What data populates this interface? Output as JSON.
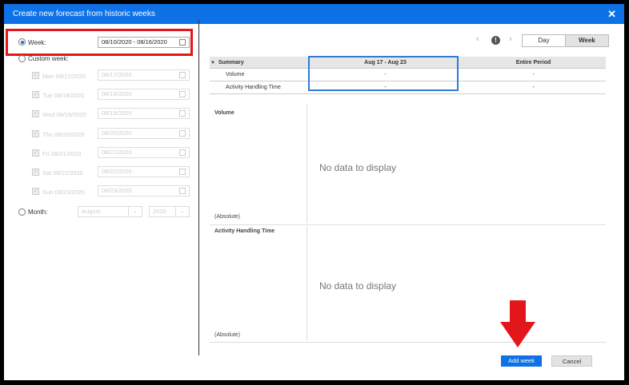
{
  "dialog": {
    "title": "Create new forecast from historic weeks",
    "close": "✕"
  },
  "left": {
    "week_label": "Week:",
    "week_value": "08/10/2020 - 08/16/2020",
    "custom_week_label": "Custom week:",
    "days": [
      {
        "label": "Mon 08/17/2020",
        "value": "08/17/2020"
      },
      {
        "label": "Tue 08/18/2020",
        "value": "08/18/2020"
      },
      {
        "label": "Wed 08/19/2020",
        "value": "08/19/2020"
      },
      {
        "label": "Thu 08/20/2020",
        "value": "08/20/2020"
      },
      {
        "label": "Fri 08/21/2020",
        "value": "08/21/2020"
      },
      {
        "label": "Sat 08/22/2020",
        "value": "08/22/2020"
      },
      {
        "label": "Sun 08/23/2020",
        "value": "08/23/2020"
      }
    ],
    "month_label": "Month:",
    "month_value": "August",
    "year_value": "2020"
  },
  "right": {
    "prev": "‹",
    "next": "›",
    "info": "!",
    "toggle_day": "Day",
    "toggle_week": "Week",
    "table_headers": [
      "Summary",
      "Aug 17 - Aug 23",
      "Entire Period"
    ],
    "table_rows": [
      {
        "label": "Volume",
        "week": "-",
        "entire": "-"
      },
      {
        "label": "Activity Handling Time",
        "week": "-",
        "entire": "-"
      }
    ],
    "panels": [
      {
        "name": "Volume",
        "note": "(Absolute)",
        "empty": "No data to display"
      },
      {
        "name": "Activity Handling Time",
        "note": "(Absolute)",
        "empty": "No data to display"
      }
    ]
  },
  "footer": {
    "add": "Add week",
    "cancel": "Cancel"
  },
  "colors": {
    "titlebar": "#0e72e6",
    "highlight_red": "#e3161b",
    "accent_blue": "#2d7bd9"
  }
}
